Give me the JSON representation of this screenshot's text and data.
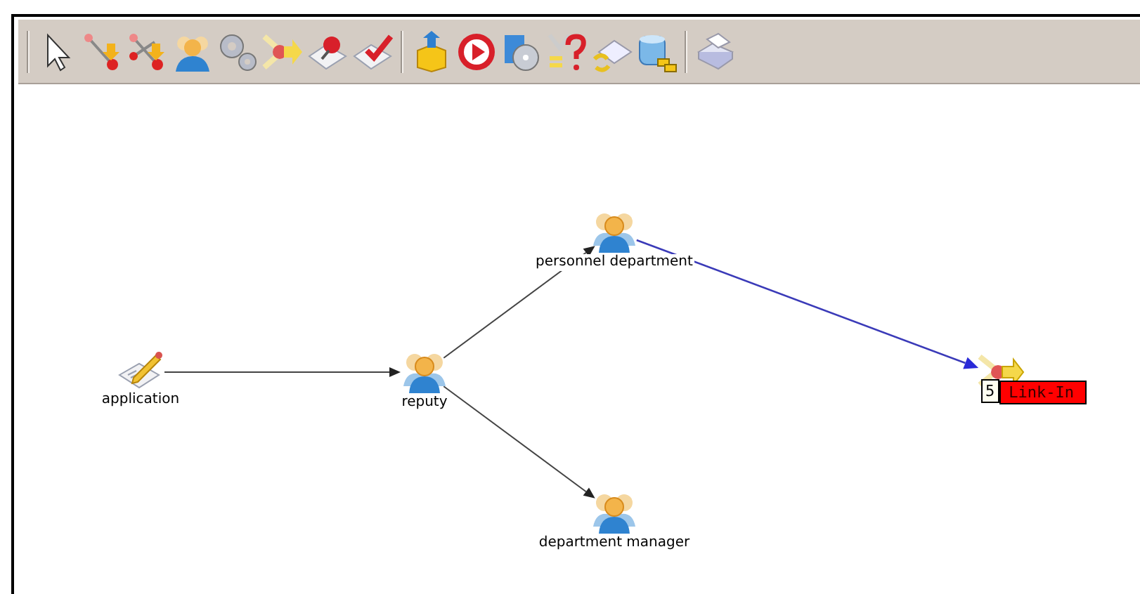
{
  "nodes": [
    {
      "label": "application",
      "kind": "document"
    },
    {
      "label": "reputy",
      "kind": "group"
    },
    {
      "label": "personnel department",
      "kind": "group"
    },
    {
      "label": "department manager",
      "kind": "group"
    },
    {
      "kind": "link"
    }
  ],
  "edges": [
    {
      "selected": false
    },
    {
      "selected": false
    },
    {
      "selected": false
    },
    {
      "selected": true
    }
  ],
  "tooltip": {
    "badge": "5",
    "text": "Link-In"
  }
}
